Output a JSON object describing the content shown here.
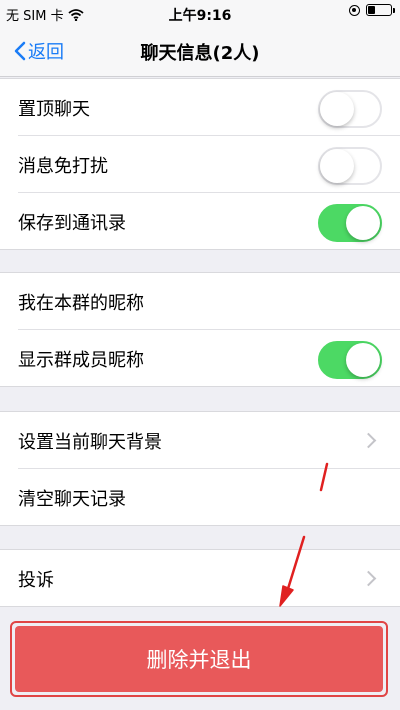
{
  "status_bar": {
    "carrier": "无 SIM 卡",
    "time": "上午9:16",
    "battery_level": 0.3
  },
  "navbar": {
    "back_label": "返回",
    "title": "聊天信息(2人)"
  },
  "group1": {
    "items": [
      {
        "label": "置顶聊天",
        "toggle": "off"
      },
      {
        "label": "消息免打扰",
        "toggle": "off"
      },
      {
        "label": "保存到通讯录",
        "toggle": "on"
      }
    ]
  },
  "group2": {
    "items": [
      {
        "label": "我在本群的昵称"
      },
      {
        "label": "显示群成员昵称",
        "toggle": "on"
      }
    ]
  },
  "group3": {
    "items": [
      {
        "label": "设置当前聊天背景"
      },
      {
        "label": "清空聊天记录"
      }
    ]
  },
  "group4": {
    "items": [
      {
        "label": "投诉"
      }
    ]
  },
  "delete_button": {
    "label": "删除并退出",
    "color": "#e8595a"
  },
  "colors": {
    "accent_blue": "#1a7cf6",
    "switch_on": "#4cd964",
    "annotation_red": "#e02020"
  }
}
